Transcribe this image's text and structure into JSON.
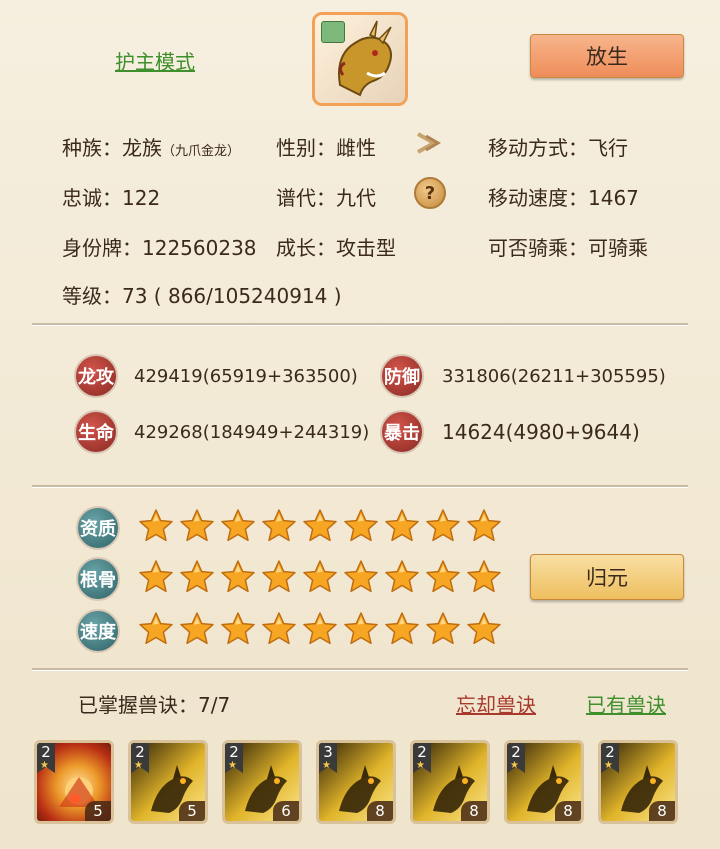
{
  "header": {
    "guard_mode_link": "护主模式",
    "release_button": "放生",
    "avatar_icon": "golden-dragon-icon"
  },
  "info": {
    "race_label": "种族：",
    "race_value": "龙族",
    "race_sub": "（九爪金龙）",
    "gender_label": "性别：",
    "gender_value": "雌性",
    "move_type_label": "移动方式：",
    "move_type_value": "飞行",
    "loyalty_label": "忠诚：",
    "loyalty_value": "122",
    "generation_label": "谱代：",
    "generation_value": "九代",
    "move_speed_label": "移动速度：",
    "move_speed_value": "1467",
    "id_label": "身份牌：",
    "id_value": "122560238",
    "growth_label": "成长：",
    "growth_value": "攻击型",
    "rideable_label": "可否骑乘：",
    "rideable_value": "可骑乘",
    "level_label": "等级：",
    "level_value": "73 ( 866/105240914 )"
  },
  "stats": {
    "attack_label": "龙攻",
    "attack_value": "429419(65919+363500)",
    "defense_label": "防御",
    "defense_value": "331806(26211+305595)",
    "life_label": "生命",
    "life_value": "429268(184949+244319)",
    "crit_label": "暴击",
    "crit_value": "14624(4980+9644)"
  },
  "ratings": {
    "aptitude_label": "资质",
    "aptitude_stars": 9,
    "bone_label": "根骨",
    "bone_stars": 9,
    "speed_label": "速度",
    "speed_stars": 9,
    "return_button": "归元",
    "star_color": "#f6a623"
  },
  "skills": {
    "mastered_label": "已掌握兽诀：7/7",
    "forget_link": "忘却兽诀",
    "owned_link": "已有兽诀",
    "items": [
      {
        "level": "2",
        "count": "5",
        "icon": "fire-burst-icon"
      },
      {
        "level": "2",
        "count": "5",
        "icon": "golden-beast-icon"
      },
      {
        "level": "2",
        "count": "6",
        "icon": "golden-beast-icon"
      },
      {
        "level": "3",
        "count": "8",
        "icon": "golden-beast-icon"
      },
      {
        "level": "2",
        "count": "8",
        "icon": "golden-beast-icon"
      },
      {
        "level": "2",
        "count": "8",
        "icon": "golden-beast-icon"
      },
      {
        "level": "2",
        "count": "8",
        "icon": "golden-beast-icon"
      }
    ]
  }
}
